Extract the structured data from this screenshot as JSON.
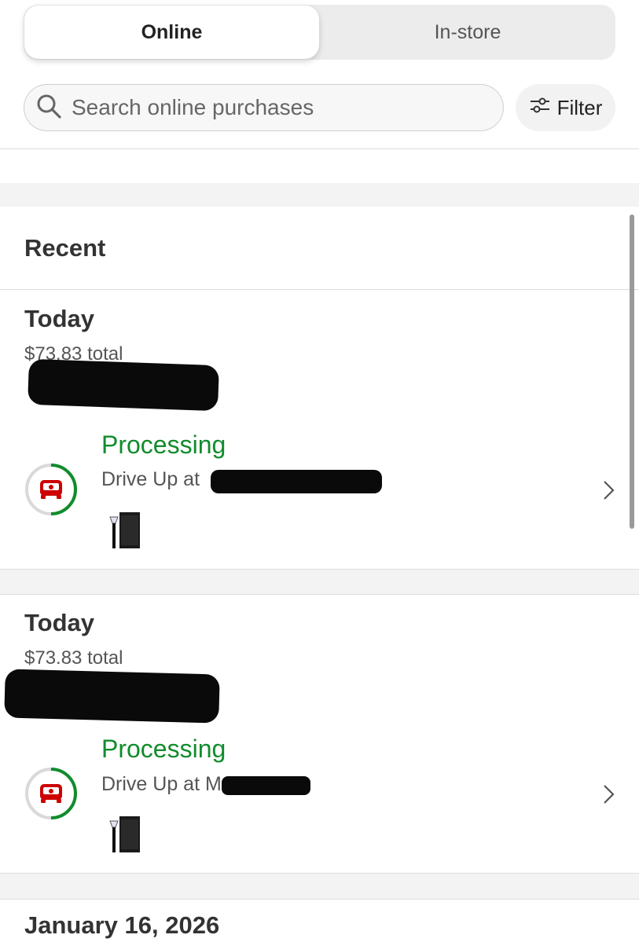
{
  "tabs": [
    {
      "label": "Online",
      "active": true
    },
    {
      "label": "In-store",
      "active": false
    }
  ],
  "search": {
    "placeholder": "Search online purchases",
    "value": ""
  },
  "filter": {
    "label": "Filter"
  },
  "section": {
    "title": "Recent"
  },
  "orders": [
    {
      "date": "Today",
      "total": "$73.83 total",
      "status": "Processing",
      "pickup": "Drive Up at "
    },
    {
      "date": "Today",
      "total": "$73.83 total",
      "status": "Processing",
      "pickup": "Drive Up at M"
    }
  ],
  "next_date_header": "January 16, 2026",
  "colors": {
    "status_green": "#118c2c",
    "brand_red": "#cc0000",
    "ring_gray": "#d9d9d9"
  },
  "icons": {
    "search": "search-icon",
    "filter": "sliders-icon",
    "drive_up": "car-icon",
    "chevron": "chevron-right-icon"
  }
}
